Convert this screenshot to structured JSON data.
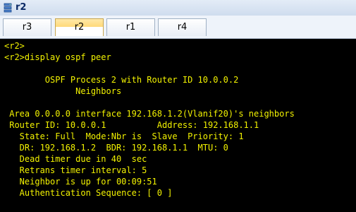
{
  "window": {
    "title": "r2",
    "icon": "router-app-icon"
  },
  "tabs": [
    {
      "label": "r3",
      "active": false
    },
    {
      "label": "r2",
      "active": true
    },
    {
      "label": "r1",
      "active": false
    },
    {
      "label": "r4",
      "active": false
    }
  ],
  "terminal": {
    "text_color": "#f2f200",
    "background": "#000000",
    "lines": [
      "<r2>",
      "<r2>display ospf peer",
      "",
      "        OSPF Process 2 with Router ID 10.0.0.2",
      "              Neighbors",
      "",
      " Area 0.0.0.0 interface 192.168.1.2(Vlanif20)'s neighbors",
      " Router ID: 10.0.0.1          Address: 192.168.1.1",
      "   State: Full  Mode:Nbr is  Slave  Priority: 1",
      "   DR: 192.168.1.2  BDR: 192.168.1.1  MTU: 0",
      "   Dead timer due in 40  sec",
      "   Retrans timer interval: 5",
      "   Neighbor is up for 00:09:51",
      "   Authentication Sequence: [ 0 ]"
    ]
  }
}
